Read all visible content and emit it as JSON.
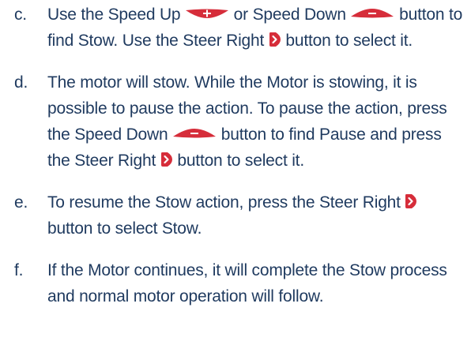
{
  "steps": [
    {
      "marker": "c.",
      "parts": [
        {
          "t": "Use the Speed Up "
        },
        {
          "icon": "speed-up-icon"
        },
        {
          "t": " or Speed Down "
        },
        {
          "icon": "speed-down-icon"
        },
        {
          "t": " button to find Stow. Use the Steer Right "
        },
        {
          "icon": "steer-right-icon"
        },
        {
          "t": " button to select it."
        }
      ]
    },
    {
      "marker": "d.",
      "parts": [
        {
          "t": "The motor will stow. While the Motor is stowing, it is possible to pause the action. To pause the action, press the Speed Down "
        },
        {
          "icon": "speed-down-icon"
        },
        {
          "t": " button to find Pause and press the Steer Right "
        },
        {
          "icon": "steer-right-icon"
        },
        {
          "t": " button to select it."
        }
      ]
    },
    {
      "marker": "e.",
      "parts": [
        {
          "t": "To resume the Stow action, press the Steer Right "
        },
        {
          "icon": "steer-right-icon"
        },
        {
          "t": " button to select Stow."
        }
      ]
    },
    {
      "marker": "f.",
      "parts": [
        {
          "t": "If the Motor continues, it will complete the Stow process and normal motor operation will follow."
        }
      ]
    }
  ],
  "colors": {
    "text": "#1f3a5f",
    "icon_red": "#d62d3a",
    "icon_white": "#ffffff"
  }
}
